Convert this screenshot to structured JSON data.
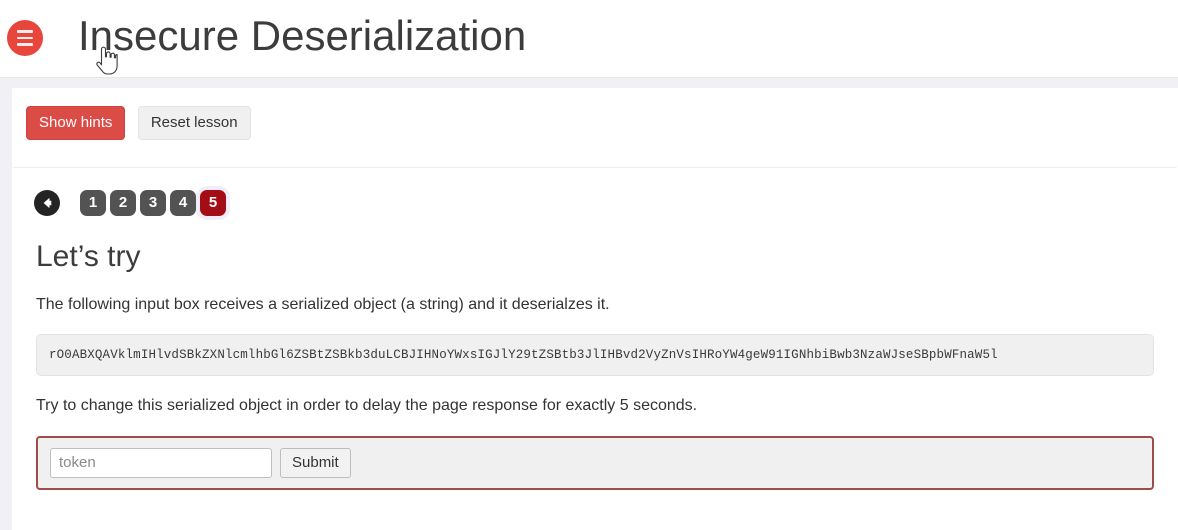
{
  "header": {
    "menu_icon": "hamburger-icon",
    "title": "Insecure Deserialization",
    "cursor_icon": "pointer-hand-cursor"
  },
  "colors": {
    "brand_red": "#e8453c",
    "button_danger": "#dc4c47",
    "active_page": "#a50d16",
    "pager_default": "#535353",
    "form_border": "#9e4b4b",
    "band_background": "#f0f0f5"
  },
  "lesson_controls": {
    "show_hints_label": "Show hints",
    "reset_lesson_label": "Reset lesson"
  },
  "pagination": {
    "back_icon": "arrow-left-icon",
    "pages": [
      {
        "label": "1",
        "active": false
      },
      {
        "label": "2",
        "active": false
      },
      {
        "label": "3",
        "active": false
      },
      {
        "label": "4",
        "active": false
      },
      {
        "label": "5",
        "active": true
      }
    ]
  },
  "lesson": {
    "heading": "Let’s try",
    "intro_text": "The following input box receives a serialized object (a string) and it deserialzes it.",
    "serialized_object": "rO0ABXQAVklmIHlvdSBkZXNlcmlhbGl6ZSBtZSBkb3duLCBJIHNoYWxsIGJlY29tZSBtb3JlIHBvd2VyZnVsIHRoYW4geW91IGNhbiBwb3NzaWJseSBpbWFnaW5l",
    "task_text": "Try to change this serialized object in order to delay the page response for exactly 5 seconds."
  },
  "attack_form": {
    "token_value": "",
    "token_placeholder": "token",
    "submit_label": "Submit"
  }
}
